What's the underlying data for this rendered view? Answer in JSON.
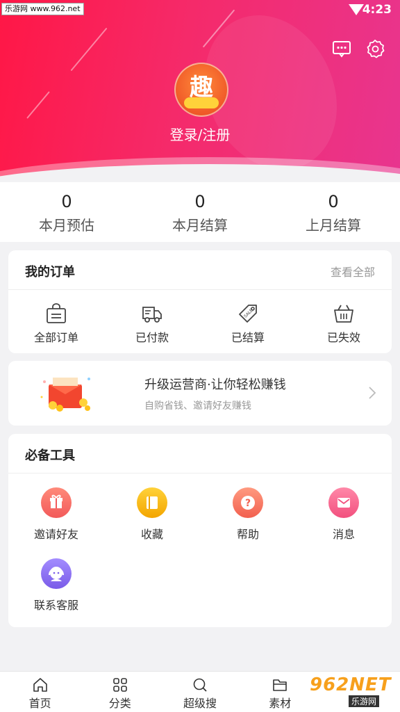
{
  "status_bar": {
    "watermark": "乐游网 www.962.net",
    "time": "4:23"
  },
  "header": {
    "avatar_glyph": "趣",
    "login_text": "登录/注册",
    "icons": [
      "message-icon",
      "settings-icon"
    ]
  },
  "stats": [
    {
      "value": "0",
      "label": "本月预估"
    },
    {
      "value": "0",
      "label": "本月结算"
    },
    {
      "value": "0",
      "label": "上月结算"
    }
  ],
  "orders": {
    "title": "我的订单",
    "view_all": "查看全部",
    "items": [
      {
        "label": "全部订单",
        "icon": "shopping-bag-icon"
      },
      {
        "label": "已付款",
        "icon": "delivery-truck-icon"
      },
      {
        "label": "已结算",
        "icon": "sale-tag-icon"
      },
      {
        "label": "已失效",
        "icon": "basket-icon"
      }
    ]
  },
  "promo": {
    "title": "升级运营商·让你轻松赚钱",
    "subtitle": "自购省钱、邀请好友赚钱"
  },
  "tools": {
    "title": "必备工具",
    "items": [
      {
        "label": "邀请好友",
        "icon": "gift-icon",
        "color": "#f86a6a"
      },
      {
        "label": "收藏",
        "icon": "bookmark-icon",
        "color": "#f7b500"
      },
      {
        "label": "帮助",
        "icon": "help-icon",
        "color": "#f8756a"
      },
      {
        "label": "消息",
        "icon": "mail-icon",
        "color": "#f65d8e"
      },
      {
        "label": "联系客服",
        "icon": "customer-service-icon",
        "color": "#8a6cf0"
      }
    ]
  },
  "tabbar": [
    {
      "label": "首页",
      "icon": "home-icon"
    },
    {
      "label": "分类",
      "icon": "category-icon"
    },
    {
      "label": "超级搜",
      "icon": "search-icon"
    },
    {
      "label": "素材",
      "icon": "folder-icon"
    }
  ],
  "brand_watermark": {
    "big": "962NET",
    "small": "乐游网"
  },
  "colors": {
    "accent": "#ff1746",
    "accent_end": "#e8358f"
  }
}
